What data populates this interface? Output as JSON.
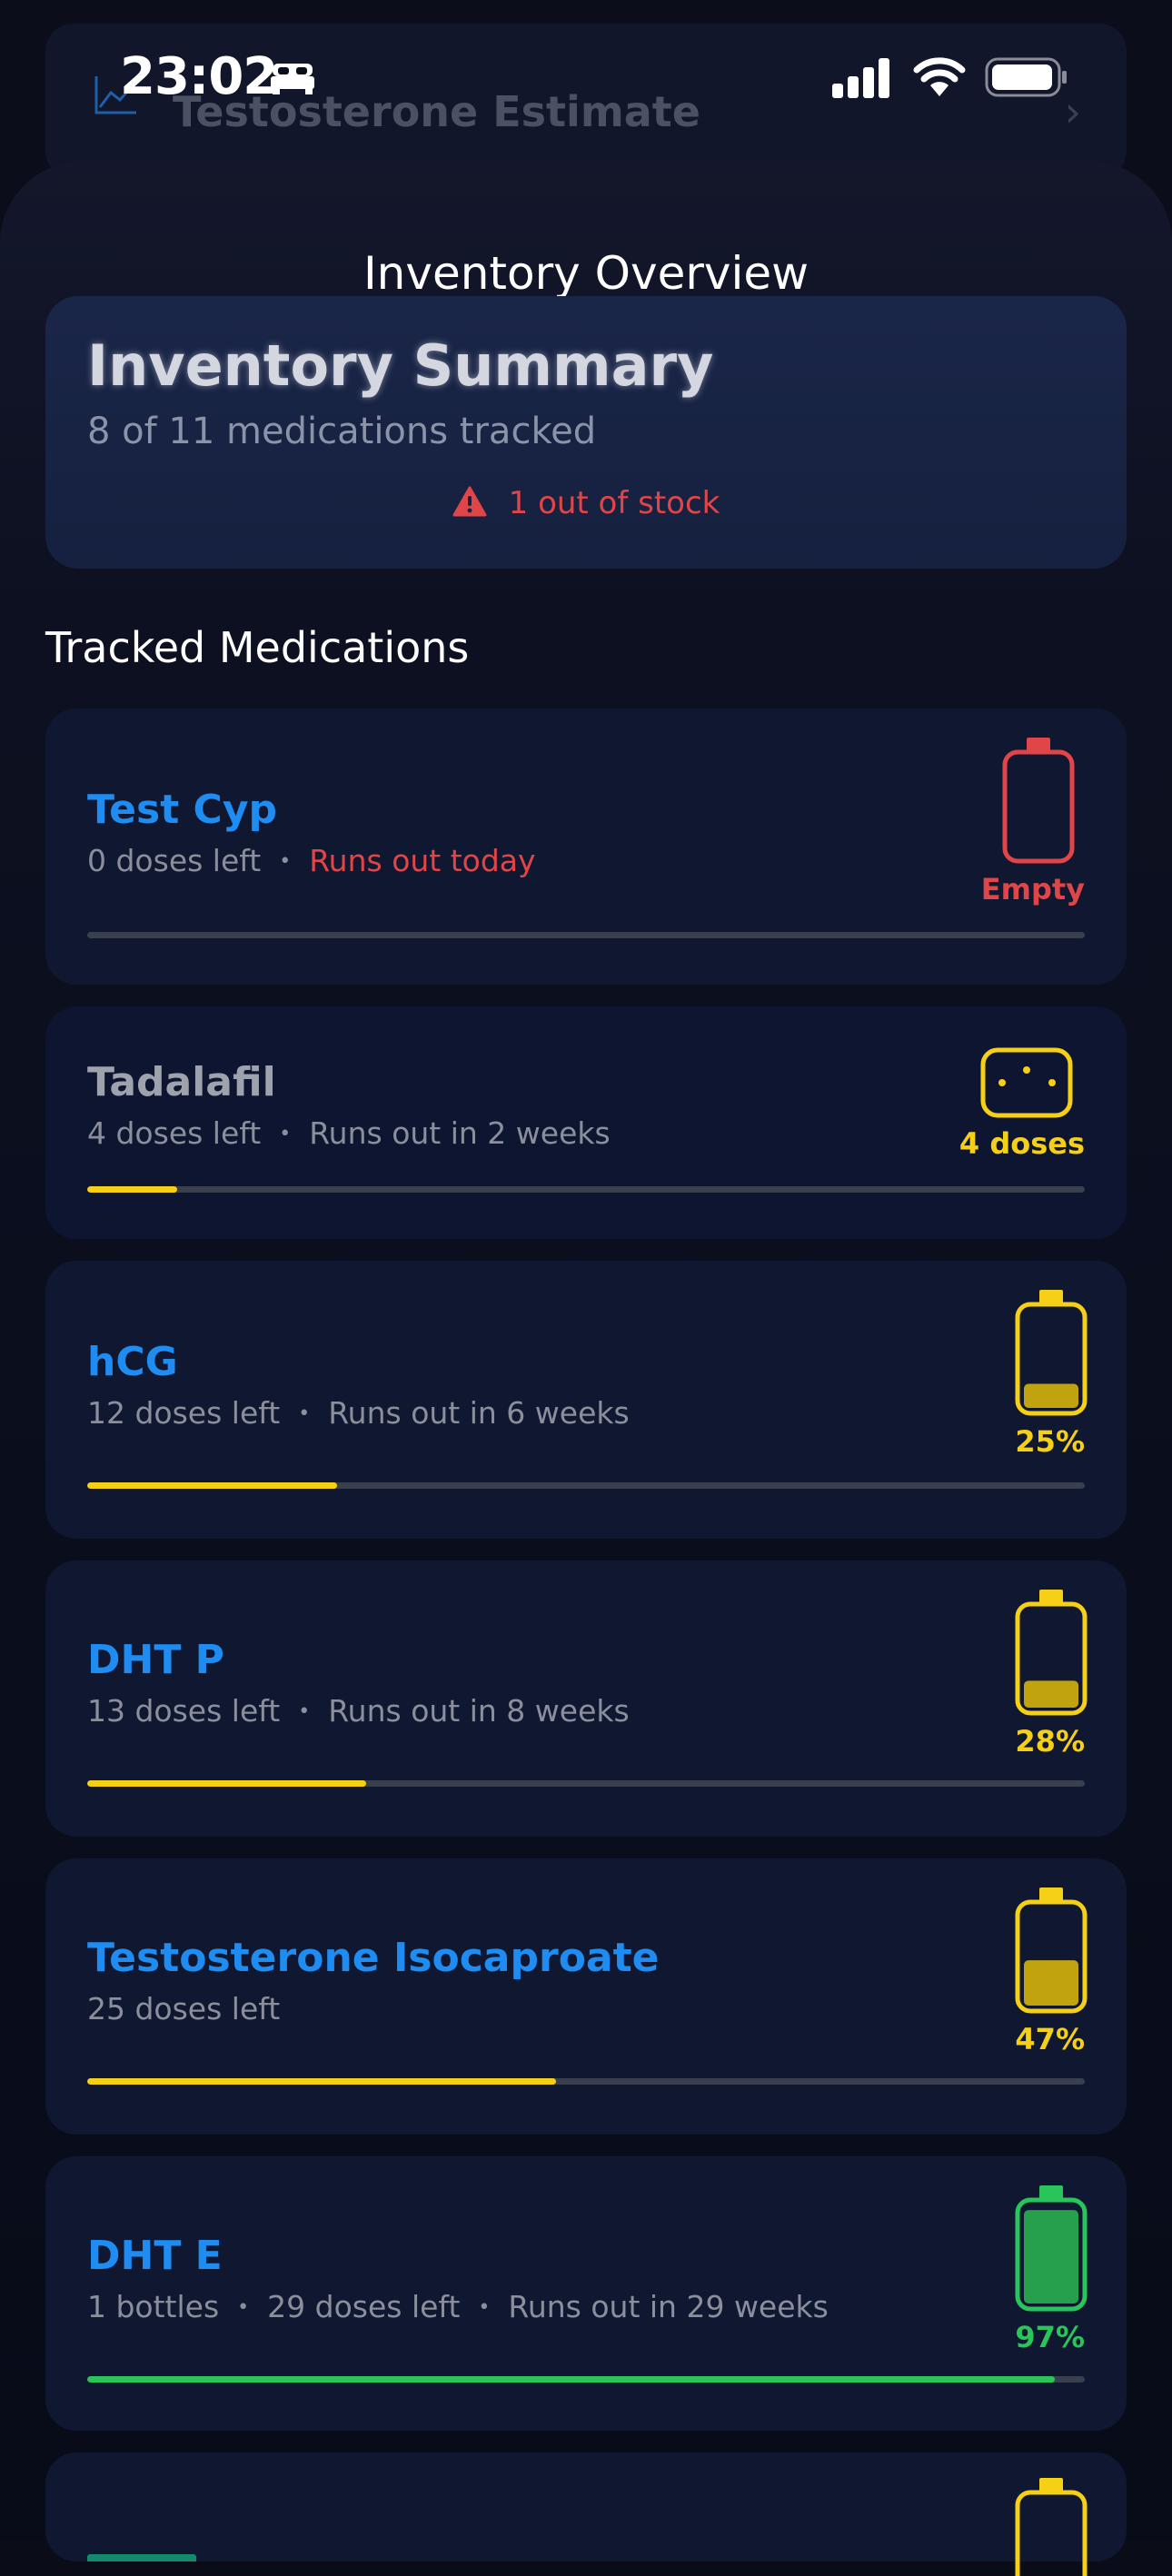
{
  "status_bar": {
    "time": "23:02"
  },
  "background": {
    "title": "Testosterone Estimate"
  },
  "sheet": {
    "title": "Inventory Overview"
  },
  "summary": {
    "title": "Inventory Summary",
    "subtitle": "8 of 11 medications tracked",
    "alert": "1 out of stock"
  },
  "section_title": "Tracked Medications",
  "colors": {
    "blue": "#1e8cf0",
    "red": "#e04548",
    "yellow": "#f5d016",
    "green": "#29c45a"
  },
  "medications": [
    {
      "name": "Test Cyp",
      "doses": "0 doses left",
      "runout": "Runs out today",
      "bottles": "",
      "indicator": "Empty",
      "level": 0.0,
      "status_color": "#e04548",
      "icon": "battery-empty-icon"
    },
    {
      "name": "Tadalafil",
      "doses": "4 doses left",
      "runout": "Runs out in 2 weeks",
      "bottles": "",
      "indicator": "4 doses",
      "level": 0.09,
      "status_color": "#f5d016",
      "icon": "pill-pack-icon"
    },
    {
      "name": "hCG",
      "doses": "12 doses left",
      "runout": "Runs out in 6 weeks",
      "bottles": "",
      "indicator": "25%",
      "level": 0.25,
      "status_color": "#f5d016",
      "icon": "battery-icon"
    },
    {
      "name": "DHT P",
      "doses": "13 doses left",
      "runout": "Runs out in 8 weeks",
      "bottles": "",
      "indicator": "28%",
      "level": 0.28,
      "status_color": "#f5d016",
      "icon": "battery-icon"
    },
    {
      "name": "Testosterone Isocaproate",
      "doses": "25 doses left",
      "runout": "",
      "bottles": "",
      "indicator": "47%",
      "level": 0.47,
      "status_color": "#f5d016",
      "icon": "battery-icon"
    },
    {
      "name": "DHT E",
      "doses": "29 doses left",
      "runout": "Runs out in 29 weeks",
      "bottles": "1 bottles",
      "indicator": "97%",
      "level": 0.97,
      "status_color": "#29c45a",
      "icon": "battery-icon"
    }
  ]
}
